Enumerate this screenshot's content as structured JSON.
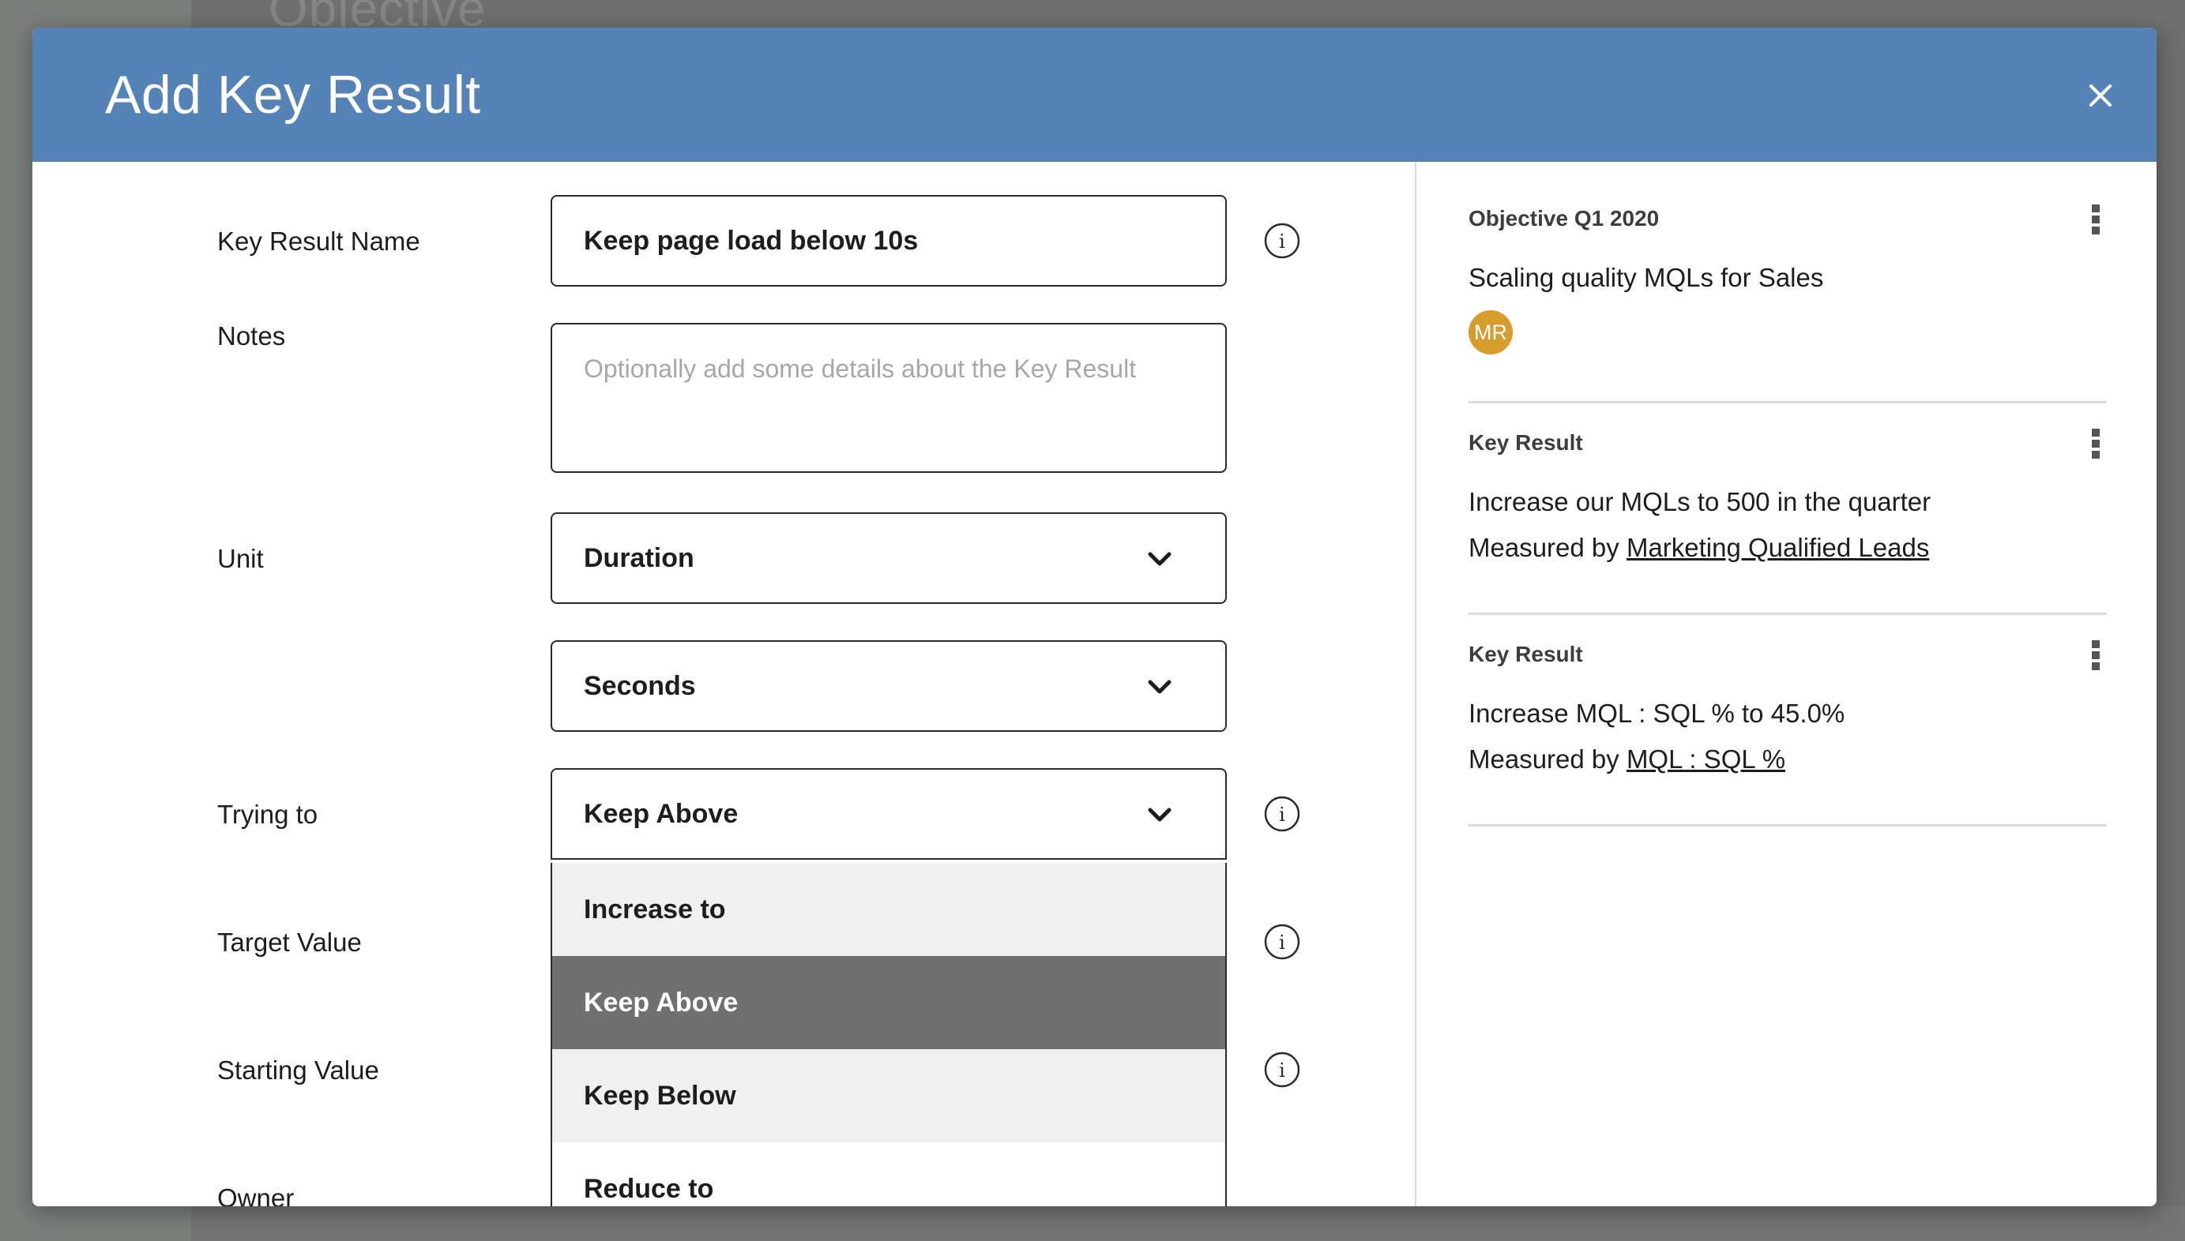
{
  "background": {
    "heading": "Objective"
  },
  "modal": {
    "title": "Add Key Result",
    "close_icon": "close-icon"
  },
  "form": {
    "key_result_name": {
      "label": "Key Result Name",
      "value": "Keep page load below 10s"
    },
    "notes": {
      "label": "Notes",
      "placeholder": "Optionally add some details about the Key Result"
    },
    "unit": {
      "label": "Unit",
      "value": "Duration",
      "sub_value": "Seconds"
    },
    "trying_to": {
      "label": "Trying to",
      "value": "Keep Above",
      "options": [
        "Increase to",
        "Keep Above",
        "Keep Below",
        "Reduce to"
      ],
      "selected_index": 1
    },
    "target_value": {
      "label": "Target Value"
    },
    "starting_value": {
      "label": "Starting Value"
    },
    "owner": {
      "label": "Owner"
    }
  },
  "sidebar": {
    "objective": {
      "label": "Objective Q1 2020",
      "title": "Scaling quality MQLs for Sales",
      "avatar_initials": "MR",
      "avatar_color": "#d79c2e"
    },
    "key_results": [
      {
        "label": "Key Result",
        "title": "Increase our MQLs to 500 in the quarter",
        "measured_prefix": "Measured by",
        "measured_link": "Marketing Qualified Leads"
      },
      {
        "label": "Key Result",
        "title": "Increase MQL : SQL % to 45.0%",
        "measured_prefix": "Measured by",
        "measured_link": "MQL : SQL %"
      }
    ]
  },
  "colors": {
    "header": "#5683b5",
    "selected_option": "#707070",
    "option_highlight": "#f0f0f0"
  }
}
